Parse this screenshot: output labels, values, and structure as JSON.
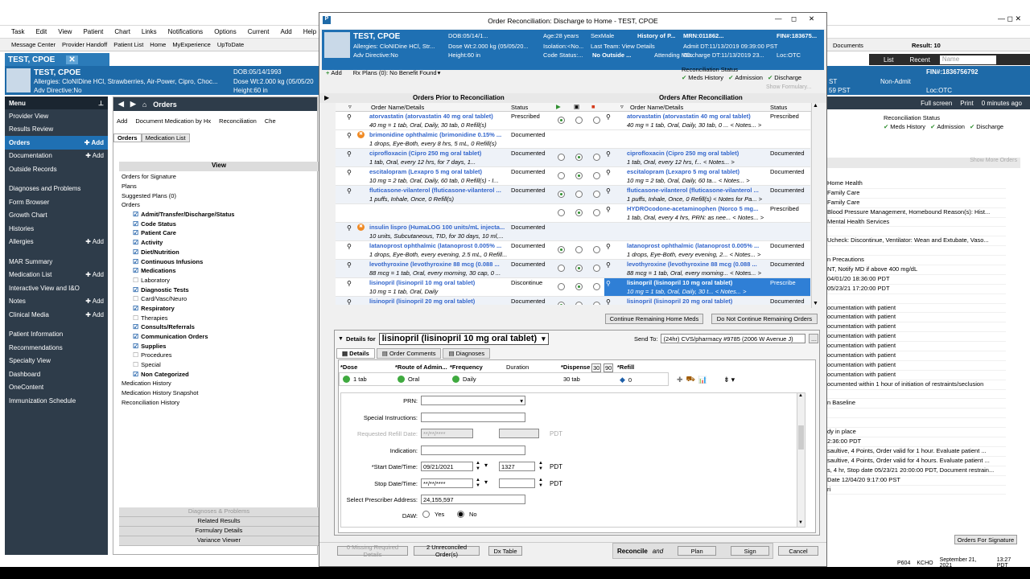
{
  "bg": {
    "menubar": [
      "Task",
      "Edit",
      "View",
      "Patient",
      "Chart",
      "Links",
      "Notifications",
      "Options",
      "Current",
      "Add",
      "Help"
    ],
    "toolbar": [
      "Message Center",
      "Provider Handoff",
      "Patient List",
      "Home",
      "MyExperience",
      "UpToDate"
    ],
    "toolbar_right": [
      "Documents",
      "Result: 10"
    ],
    "patient_tab": "TEST, CPOE",
    "banner": {
      "name": "TEST, CPOE",
      "allergies": "Allergies: CloNIDine HCl, Strawberries, Air-Power, Cipro, Choc...",
      "adv": "Adv Directive:No",
      "dob": "DOB:05/14/1993",
      "dose_wt": "Dose Wt:2.000 kg (05/05/20",
      "height": "Height:60 in",
      "fin": "FIN#:1836756792",
      "non_admit": "Non-Admit",
      "loc": "Loc:OTC",
      "pst": "59 PST",
      "st": "ST"
    },
    "list_label": "List",
    "recent_label": "Recent",
    "name_placeholder": "Name",
    "menu_title": "Menu",
    "menu_items": [
      {
        "label": "Provider View",
        "add": ""
      },
      {
        "label": "Results Review",
        "add": ""
      },
      {
        "label": "Orders",
        "add": "Add"
      },
      {
        "label": "Documentation",
        "add": "Add"
      },
      {
        "label": "Outside Records",
        "add": ""
      },
      {
        "label": "Diagnoses and Problems",
        "add": ""
      },
      {
        "label": "Form Browser",
        "add": ""
      },
      {
        "label": "Growth Chart",
        "add": ""
      },
      {
        "label": "Histories",
        "add": ""
      },
      {
        "label": "Allergies",
        "add": "Add"
      },
      {
        "label": "MAR Summary",
        "add": ""
      },
      {
        "label": "Medication List",
        "add": "Add"
      },
      {
        "label": "Interactive View and I&O",
        "add": ""
      },
      {
        "label": "Notes",
        "add": "Add"
      },
      {
        "label": "Clinical Media",
        "add": "Add"
      },
      {
        "label": "Patient Information",
        "add": ""
      },
      {
        "label": "Recommendations",
        "add": ""
      },
      {
        "label": "Specialty View",
        "add": ""
      },
      {
        "label": "Dashboard",
        "add": ""
      },
      {
        "label": "OneContent",
        "add": ""
      },
      {
        "label": "Immunization Schedule",
        "add": ""
      }
    ],
    "center_header": "Orders",
    "center_toolbar": [
      "Add",
      "Document Medication by Hx",
      "Reconciliation",
      "Che"
    ],
    "center_tabs": [
      "Orders",
      "Medication List"
    ],
    "view_header": "View",
    "view_items": [
      {
        "label": "Orders for Signature",
        "indent": 0,
        "bold": false,
        "chk": false
      },
      {
        "label": "Plans",
        "indent": 0,
        "bold": false,
        "chk": false
      },
      {
        "label": "Suggested Plans (0)",
        "indent": 0,
        "bold": false,
        "chk": false
      },
      {
        "label": "Orders",
        "indent": 0,
        "bold": false,
        "chk": false
      },
      {
        "label": "Admit/Transfer/Discharge/Status",
        "indent": 1,
        "bold": true,
        "chk": true
      },
      {
        "label": "Code Status",
        "indent": 1,
        "bold": true,
        "chk": true
      },
      {
        "label": "Patient Care",
        "indent": 1,
        "bold": true,
        "chk": true
      },
      {
        "label": "Activity",
        "indent": 1,
        "bold": true,
        "chk": true
      },
      {
        "label": "Diet/Nutrition",
        "indent": 1,
        "bold": true,
        "chk": true
      },
      {
        "label": "Continuous Infusions",
        "indent": 1,
        "bold": true,
        "chk": true
      },
      {
        "label": "Medications",
        "indent": 1,
        "bold": true,
        "chk": true
      },
      {
        "label": "Laboratory",
        "indent": 1,
        "bold": false,
        "chk": false
      },
      {
        "label": "Diagnostic Tests",
        "indent": 1,
        "bold": true,
        "chk": true
      },
      {
        "label": "Card/Vasc/Neuro",
        "indent": 1,
        "bold": false,
        "chk": false
      },
      {
        "label": "Respiratory",
        "indent": 1,
        "bold": true,
        "chk": true
      },
      {
        "label": "Therapies",
        "indent": 1,
        "bold": false,
        "chk": false
      },
      {
        "label": "Consults/Referrals",
        "indent": 1,
        "bold": true,
        "chk": true
      },
      {
        "label": "Communication Orders",
        "indent": 1,
        "bold": true,
        "chk": true
      },
      {
        "label": "Supplies",
        "indent": 1,
        "bold": true,
        "chk": true
      },
      {
        "label": "Procedures",
        "indent": 1,
        "bold": false,
        "chk": false
      },
      {
        "label": "Special",
        "indent": 1,
        "bold": false,
        "chk": false
      },
      {
        "label": "Non Categorized",
        "indent": 1,
        "bold": true,
        "chk": true
      },
      {
        "label": "Medication History",
        "indent": 0,
        "bold": false,
        "chk": false
      },
      {
        "label": "Medication History Snapshot",
        "indent": 0,
        "bold": false,
        "chk": false
      },
      {
        "label": "Reconciliation History",
        "indent": 0,
        "bold": false,
        "chk": false
      }
    ],
    "center_footer": [
      "Diagnoses & Problems",
      "Related Results",
      "Formulary Details",
      "Variance Viewer"
    ],
    "right_top": [
      "Full screen",
      "Print",
      "0 minutes ago"
    ],
    "right_recon": "Reconciliation Status",
    "right_recon_items": [
      "Meds History",
      "Admission",
      "Discharge"
    ],
    "right_show_more": "Show More Orders",
    "right_lines": [
      "Home Health",
      "Family Care",
      "Family Care",
      "Blood Pressure Management, Homebound Reason(s): Hist...",
      "Mental Health Services",
      "",
      "Ucheck: Discontinue, Ventilator: Wean and Extubate, Vaso...",
      "",
      "n Precautions",
      "NT, Notify MD if above 400 mg/dL",
      "04/01/20 18:36:00 PDT",
      "05/23/21 17:20:00 PDT",
      "",
      "ocumentation with patient",
      "ocumentation with patient",
      "ocumentation with patient",
      "ocumentation with patient",
      "ocumentation with patient",
      "ocumentation with patient",
      "ocumentation with patient",
      "ocumentation with patient",
      "ocumented within 1 hour of initiation of restraints/seclusion",
      "",
      "n Baseline",
      "",
      "",
      "dy in place",
      "2:36:00 PDT",
      "saultive, 4 Points, Order valid for 1 hour.  Evaluate patient ...",
      "saultive, 4 Points, Order valid for 4 hours.  Evaluate patient ...",
      "s, 4 hr, Stop date 05/23/21 20:00:00 PDT, Document restrain...",
      "Date 12/04/20 9:17:00 PST",
      "ri"
    ],
    "right_footer_btn": "Orders For Signature",
    "status_bar": [
      "P604",
      "KCHO",
      "September 21, 2021",
      "13:27 PDT"
    ]
  },
  "dialog": {
    "title": "Order Reconciliation:  Discharge to Home - TEST, CPOE",
    "banner": {
      "name": "TEST, CPOE",
      "allergies": "Allergies: CloNIDine HCl, Str...",
      "adv": "Adv Directive:No",
      "dob": "DOB:05/14/1...",
      "dose_wt": "Dose Wt:2.000 kg (05/05/20...",
      "height": "Height:60 in",
      "age": "Age:28 years",
      "isolation": "Isolation:<No...",
      "code_status": "Code Status:...",
      "sex": "SexMale",
      "last_team": "Last Team: View Details",
      "no_outside": "No Outside ...",
      "history": "History of P...",
      "mrn": "MRN:011862...",
      "attending": "Attending MD:",
      "fin": "FIN#:183675...",
      "admit": "Admit DT:11/13/2019 09:39:00 PST",
      "discharge": "Discharge DT:11/13/2019 23...",
      "loc": "Loc:OTC"
    },
    "toolbar": {
      "add": "Add",
      "rx_plans": "Rx Plans (0): No Benefit Found"
    },
    "recon_status": {
      "label": "Reconciliation Status",
      "items": [
        "Meds History",
        "Admission",
        "Discharge"
      ],
      "show_formulary": "Show Formulary..."
    },
    "prior_header": "Orders Prior to Reconciliation",
    "after_header": "Orders After Reconciliation",
    "col_name": "Order Name/Details",
    "col_status": "Status",
    "rows": [
      {
        "name": "atorvastatin (atorvastatin 40 mg oral tablet)",
        "detail": "40 mg = 1 tab, Oral, Daily, 30 tab, 0 Refill(s)",
        "status": "Prescribed",
        "sel": 0,
        "after_name": "atorvastatin (atorvastatin 40 mg oral tablet)",
        "after_detail": "40 mg = 1 tab, Oral, Daily, 30 tab, 0 ... < Notes... >",
        "after_status": "Prescribed",
        "warn": false,
        "alt": false,
        "hl": false
      },
      {
        "name": "brimonidine ophthalmic (brimonidine 0.15% ...",
        "detail": "1 drops, Eye-Both, every 8 hrs, 5 mL, 0 Refill(s)",
        "status": "Documented",
        "sel": -1,
        "after_name": "",
        "after_detail": "",
        "after_status": "",
        "warn": true,
        "alt": false,
        "hl": false
      },
      {
        "name": "ciprofloxacin (Cipro 250 mg oral tablet)",
        "detail": "1 tab, Oral, every 12 hrs, for 7 days, 1...",
        "status": "Documented",
        "sel": 1,
        "after_name": "ciprofloxacin (Cipro 250 mg oral tablet)",
        "after_detail": "1 tab, Oral, every 12 hrs, f... < Notes... >",
        "after_status": "Documented",
        "warn": false,
        "alt": true,
        "hl": false
      },
      {
        "name": "escitalopram (Lexapro 5 mg oral tablet)",
        "detail": "10 mg = 2 tab, Oral, Daily, 60 tab, 0 Refill(s) - I...",
        "status": "Documented",
        "sel": 1,
        "after_name": "escitalopram (Lexapro 5 mg oral tablet)",
        "after_detail": "10 mg = 2 tab, Oral, Daily, 60 ta... < Notes... >",
        "after_status": "Documented",
        "warn": false,
        "alt": false,
        "hl": false
      },
      {
        "name": "fluticasone-vilanterol (fluticasone-vilanterol ...",
        "detail": "1 puffs, Inhale, Once, 0 Refill(s)",
        "status": "Documented",
        "sel": 0,
        "after_name": "fluticasone-vilanterol (fluticasone-vilanterol ...",
        "after_detail": "1 puffs, Inhale, Once, 0 Refill(s) < Notes for Pa... >",
        "after_status": "Documented",
        "warn": false,
        "alt": true,
        "hl": false
      },
      {
        "name": "",
        "detail": "",
        "status": "",
        "sel": 1,
        "after_name": "HYDROcodone-acetaminophen (Norco 5 mg...",
        "after_detail": "1 tab, Oral, every 4 hrs, PRN: as nee... < Notes... >",
        "after_status": "Prescribed",
        "warn": false,
        "alt": false,
        "hl": false
      },
      {
        "name": "insulin lispro (HumaLOG 100 units/mL injecta...",
        "detail": "10 units, Subcutaneous, TID, for 30 days, 10 ml,...",
        "status": "Documented",
        "sel": -1,
        "after_name": "",
        "after_detail": "",
        "after_status": "",
        "warn": true,
        "alt": true,
        "hl": false
      },
      {
        "name": "latanoprost ophthalmic (latanoprost 0.005% ...",
        "detail": "1 drops, Eye-Both, every evening, 2.5 mL, 0 Refill...",
        "status": "Documented",
        "sel": 0,
        "after_name": "latanoprost ophthalmic (latanoprost 0.005% ...",
        "after_detail": "1 drops, Eye-Both, every evening, 2... < Notes... >",
        "after_status": "Documented",
        "warn": false,
        "alt": false,
        "hl": false
      },
      {
        "name": "levothyroxine (levothyroxine 88 mcg (0.088 ...",
        "detail": "88 mcg = 1 tab, Oral, every morning, 30 cap, 0 ...",
        "status": "Documented",
        "sel": 1,
        "after_name": "levothyroxine (levothyroxine 88 mcg (0.088 ...",
        "after_detail": "88 mcg = 1 tab, Oral, every morning... < Notes... >",
        "after_status": "Documented",
        "warn": false,
        "alt": true,
        "hl": false
      },
      {
        "name": "lisinopril (lisinopril 10 mg oral tablet)",
        "detail": "10 mg = 1 tab, Oral, Daily",
        "status": "Discontinue",
        "sel": 1,
        "after_name": "lisinopril (lisinopril 10 mg oral tablet)",
        "after_detail": "10 mg = 1 tab, Oral, Daily, 30 t... < Notes... >",
        "after_status": "Prescribe",
        "warn": false,
        "alt": false,
        "hl": true
      },
      {
        "name": "lisinopril (lisinopril 20 mg oral tablet)",
        "detail": "10 mg = 0.5 tab, Oral, every other day, 90 tab, 0...",
        "status": "Documented",
        "sel": 0,
        "after_name": "lisinopril (lisinopril 20 mg oral tablet)",
        "after_detail": "10 mg = 0.5 tab, Oral, every other d... < Notes... >",
        "after_status": "Documented",
        "warn": false,
        "alt": true,
        "hl": false
      }
    ],
    "continue_btn": "Continue Remaining Home Meds",
    "not_continue_btn": "Do Not Continue Remaining Orders",
    "details_label": "Details for",
    "details_for": "lisinopril (lisinopril 10 mg oral tablet)",
    "send_to_label": "Send To:",
    "send_to": "(24hr) CVS/pharmacy #9785 (2006 W Avenue J)",
    "tabs": [
      "Details",
      "Order Comments",
      "Diagnoses"
    ],
    "field_headers": {
      "dose": "*Dose",
      "route": "*Route of Admin...",
      "freq": "*Frequency",
      "duration": "Duration",
      "dispense": "*Dispense",
      "d30": "30",
      "d90": "90",
      "refill": "*Refill"
    },
    "field_values": {
      "dose": "1 tab",
      "route": "Oral",
      "freq": "Daily",
      "duration": "",
      "dispense": "30 tab",
      "refill": "0"
    },
    "form": {
      "prn": "PRN:",
      "special": "Special Instructions:",
      "requested_refill": "Requested Refill Date:",
      "refill_date": "**/**/****",
      "pdt": "PDT",
      "indication": "Indication:",
      "start": "*Start Date/Time:",
      "start_date": "09/21/2021",
      "start_time": "1327",
      "stop": "Stop Date/Time:",
      "stop_date": "**/**/****",
      "prescriber": "Select Prescriber Address:",
      "prescriber_val": "24,155,597",
      "daw": "DAW:",
      "yes": "Yes",
      "no": "No"
    },
    "footer": {
      "missing": "0 Missing Required Details",
      "unreconciled": "2 Unreconciled Order(s)",
      "dx": "Dx Table",
      "reconcile": "Reconcile",
      "and": "and",
      "plan": "Plan",
      "sign": "Sign",
      "cancel": "Cancel"
    }
  }
}
